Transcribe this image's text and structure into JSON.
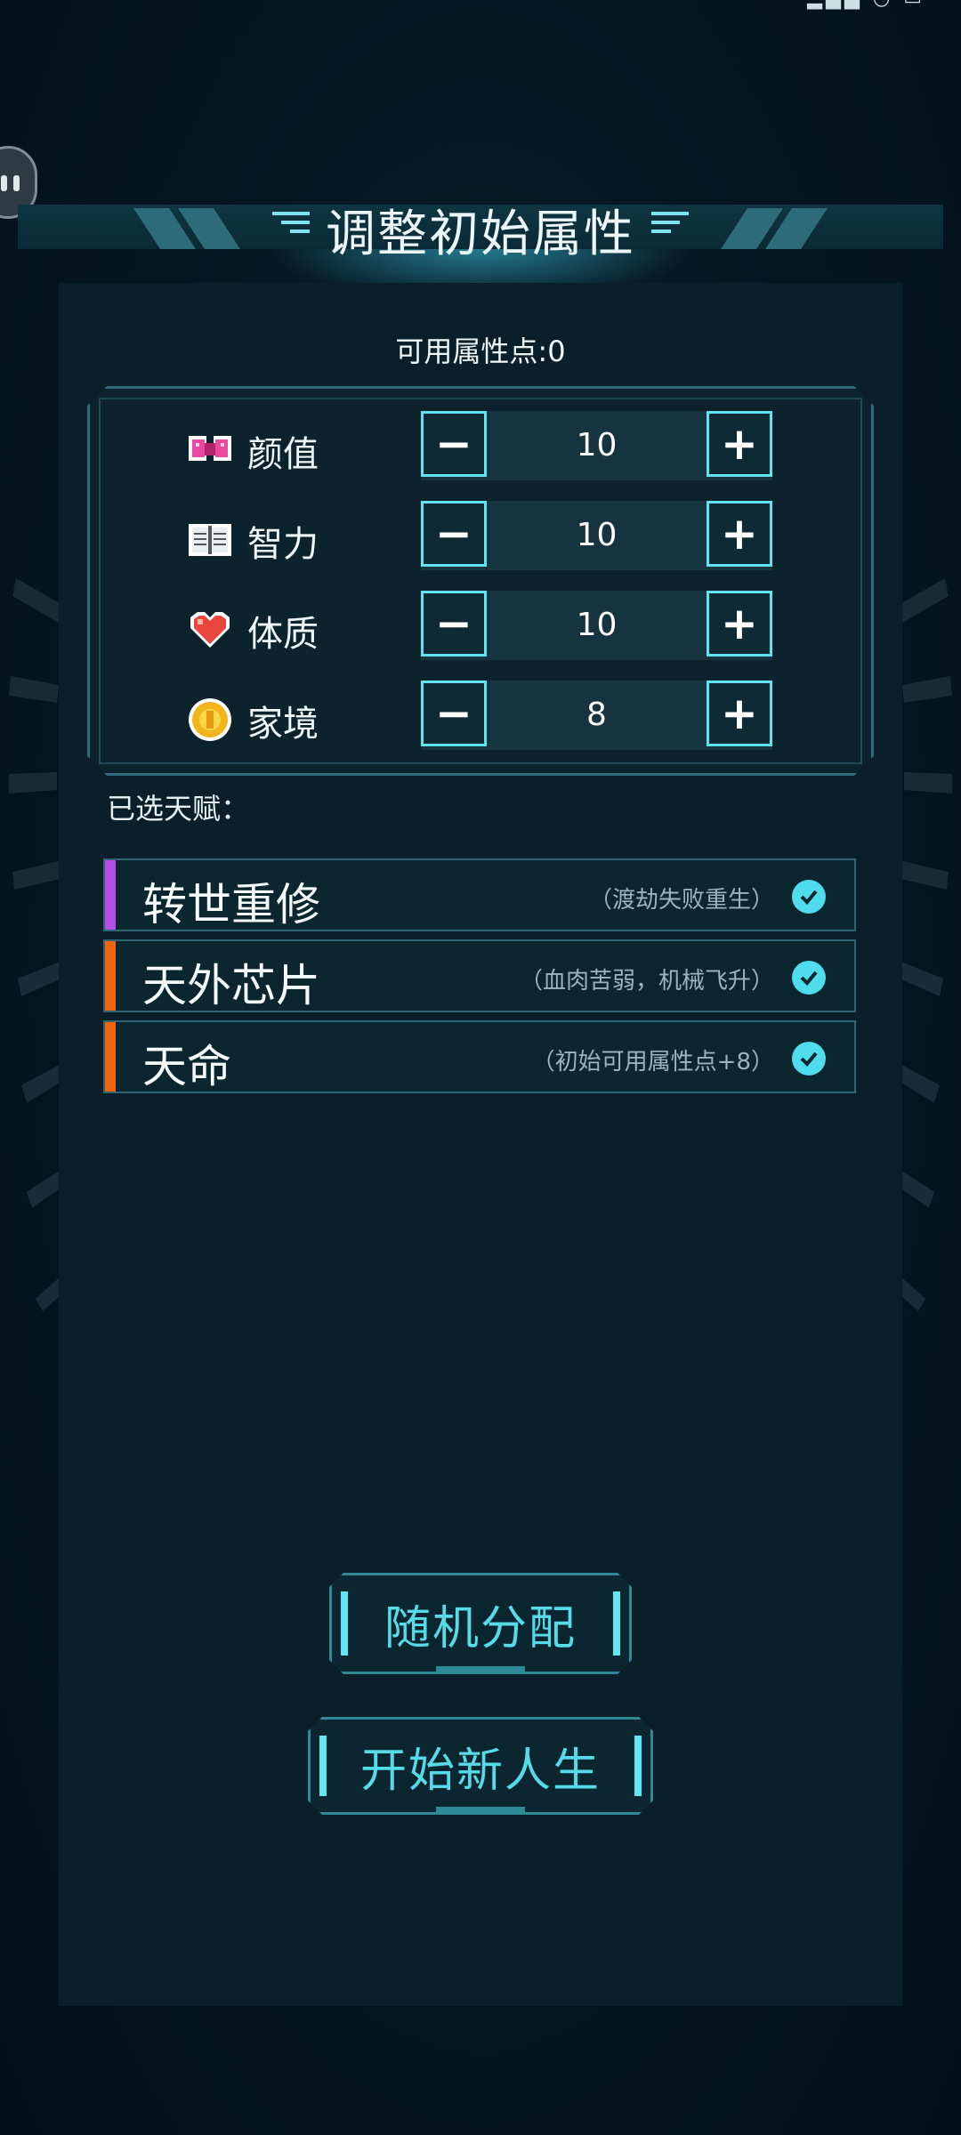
{
  "header": {
    "title": "调整初始属性"
  },
  "available_points": {
    "label": "可用属性点:0"
  },
  "attributes": [
    {
      "name": "颜值",
      "icon": "bow-icon",
      "value": "10",
      "minus": "−",
      "plus": "+"
    },
    {
      "name": "智力",
      "icon": "book-icon",
      "value": "10",
      "minus": "−",
      "plus": "+"
    },
    {
      "name": "体质",
      "icon": "heart-icon",
      "value": "10",
      "minus": "−",
      "plus": "+"
    },
    {
      "name": "家境",
      "icon": "coin-icon",
      "value": "8",
      "minus": "−",
      "plus": "+"
    }
  ],
  "talents_label": "已选天赋：",
  "talents": [
    {
      "name": "转世重修",
      "desc": "（渡劫失败重生）",
      "color": "#b44ce8"
    },
    {
      "name": "天外芯片",
      "desc": "（血肉苦弱，机械飞升）",
      "color": "#f0650f"
    },
    {
      "name": "天命",
      "desc": "（初始可用属性点+8）",
      "color": "#f0650f"
    }
  ],
  "buttons": {
    "random": "随机分配",
    "start": "开始新人生"
  },
  "colors": {
    "accent": "#56dbe8",
    "panel": "#0a1f29",
    "background": "#04121c"
  }
}
